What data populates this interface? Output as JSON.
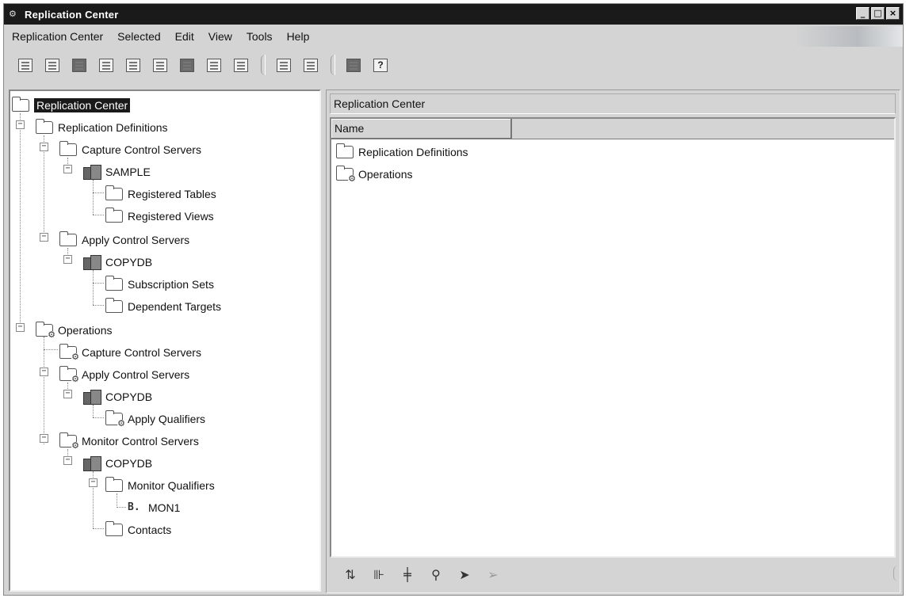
{
  "window": {
    "title": "Replication Center",
    "controls": {
      "minimize": "_",
      "maximize": "□",
      "close": "×"
    }
  },
  "menu": [
    "Replication Center",
    "Selected",
    "Edit",
    "View",
    "Tools",
    "Help"
  ],
  "toolbar": {
    "icons": [
      "tree-collapse-icon",
      "tree-expand-icon",
      "launchpad-icon",
      "clipboard-icon",
      "table-icon",
      "list-icon",
      "monitor-icon",
      "window-icon",
      "dialog-icon",
      "grid-left-icon",
      "grid-right-icon",
      "task-icon",
      "help-icon"
    ],
    "help_glyph": "?"
  },
  "tree": {
    "root": "Replication Center",
    "nodes": [
      {
        "label": "Replication Definitions",
        "icon": "folder"
      },
      {
        "label": "Capture Control Servers",
        "icon": "folder"
      },
      {
        "label": "SAMPLE",
        "icon": "server"
      },
      {
        "label": "Registered Tables",
        "icon": "folder"
      },
      {
        "label": "Registered Views",
        "icon": "folder"
      },
      {
        "label": "Apply Control Servers",
        "icon": "folder"
      },
      {
        "label": "COPYDB",
        "icon": "server"
      },
      {
        "label": "Subscription Sets",
        "icon": "folder"
      },
      {
        "label": "Dependent Targets",
        "icon": "folder"
      },
      {
        "label": "Operations",
        "icon": "folder-gear"
      },
      {
        "label": "Capture Control Servers",
        "icon": "folder-gear"
      },
      {
        "label": "Apply Control Servers",
        "icon": "folder-gear"
      },
      {
        "label": "COPYDB",
        "icon": "server"
      },
      {
        "label": "Apply Qualifiers",
        "icon": "folder-gear"
      },
      {
        "label": "Monitor Control Servers",
        "icon": "folder-gear"
      },
      {
        "label": "COPYDB",
        "icon": "server"
      },
      {
        "label": "Monitor Qualifiers",
        "icon": "folder"
      },
      {
        "label": "MON1",
        "icon": "monitor-qualifier"
      },
      {
        "label": "Contacts",
        "icon": "folder"
      }
    ]
  },
  "details": {
    "header": "Replication Center",
    "column": "Name",
    "rows": [
      {
        "label": "Replication Definitions",
        "icon": "folder"
      },
      {
        "label": "Operations",
        "icon": "folder-gear"
      }
    ]
  },
  "bottom_toolbar": {
    "icons": [
      "sort-icon",
      "filter-icon",
      "customize-columns-icon",
      "find-icon",
      "select-all-icon",
      "deselect-all-icon"
    ]
  }
}
